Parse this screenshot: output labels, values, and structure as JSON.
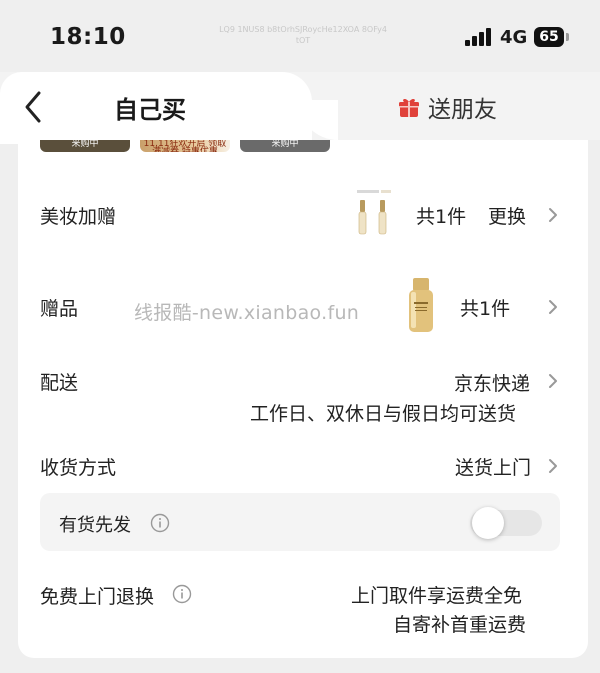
{
  "status_bar": {
    "time": "18:10",
    "overlay_text": "LQ9 1NUS8 b8tOrhSJRoycHe12XOA 8OFy4tOT",
    "network": "4G",
    "battery": "65"
  },
  "tabs": {
    "self_buy": "自己买",
    "gift_friend": "送朋友"
  },
  "promo_tiles": [
    "来购中",
    "11.11狂欢开启  领取满减券 特惠优惠",
    "来购中"
  ],
  "rows": {
    "beauty_gift": {
      "label": "美妆加赠",
      "count": "共1件",
      "action": "更换"
    },
    "gift": {
      "label": "赠品",
      "count": "共1件"
    },
    "delivery": {
      "label": "配送",
      "carrier": "京东快递",
      "schedule": "工作日、双休日与假日均可送货"
    },
    "receive_method": {
      "label": "收货方式",
      "value": "送货上门"
    },
    "in_stock": {
      "label": "有货先发",
      "enabled": false
    },
    "free_return": {
      "label": "免费上门退换",
      "line1": "上门取件享运费全免",
      "line2": "自寄补首重运费"
    }
  },
  "watermark": "线报酷-new.xianbao.fun",
  "colors": {
    "gift_icon": "#e0413a",
    "chevron": "#999999",
    "toggle_off": "#e6e6e6"
  }
}
